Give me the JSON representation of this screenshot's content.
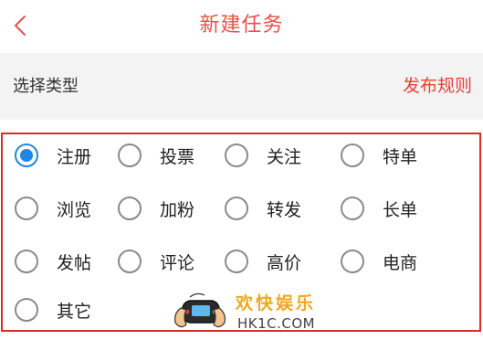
{
  "header": {
    "title": "新建任务",
    "back_icon": "chevron-left-icon",
    "accent_color": "#e8504a"
  },
  "type_bar": {
    "label": "选择类型",
    "rules_link": "发布规则"
  },
  "options": [
    {
      "label": "注册",
      "selected": true
    },
    {
      "label": "投票",
      "selected": false
    },
    {
      "label": "关注",
      "selected": false
    },
    {
      "label": "特单",
      "selected": false
    },
    {
      "label": "浏览",
      "selected": false
    },
    {
      "label": "加粉",
      "selected": false
    },
    {
      "label": "转发",
      "selected": false
    },
    {
      "label": "长单",
      "selected": false
    },
    {
      "label": "发帖",
      "selected": false
    },
    {
      "label": "评论",
      "selected": false
    },
    {
      "label": "高价",
      "selected": false
    },
    {
      "label": "电商",
      "selected": false
    },
    {
      "label": "其它",
      "selected": false
    }
  ],
  "radio_selected_color": "#1f87e5",
  "watermark": {
    "name": "欢快娱乐",
    "url": "HK1C.COM"
  }
}
